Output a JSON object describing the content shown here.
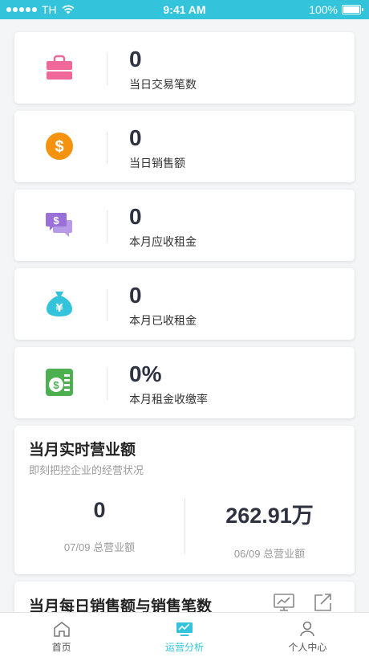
{
  "status_bar": {
    "carrier": "TH",
    "time": "9:41 AM",
    "battery": "100%"
  },
  "stats": [
    {
      "value": "0",
      "label": "当日交易笔数",
      "icon": "shopping-bag-icon",
      "color": "#f0679a"
    },
    {
      "value": "0",
      "label": "当日销售额",
      "icon": "dollar-coin-icon",
      "color": "#f5930f"
    },
    {
      "value": "0",
      "label": "本月应收租金",
      "icon": "chat-dollar-icon",
      "color": "#9b6fd8"
    },
    {
      "value": "0",
      "label": "本月已收租金",
      "icon": "money-bag-yuan-icon",
      "color": "#33c4db"
    },
    {
      "value": "0%",
      "label": "本月租金收缴率",
      "icon": "coin-list-icon",
      "color": "#4caf50"
    }
  ],
  "monthly": {
    "title": "当月实时营业额",
    "subtitle": "即刻把控企业的经营状况",
    "left_value": "0",
    "left_label": "07/09 总营业额",
    "right_value": "262.91万",
    "right_label": "06/09 总营业额"
  },
  "daily": {
    "title": "当月每日销售额与销售笔数",
    "chart_icon": "line-chart-icon",
    "export_icon": "share-icon"
  },
  "tabs": [
    {
      "label": "首页",
      "icon": "home-icon"
    },
    {
      "label": "运营分析",
      "icon": "analytics-icon",
      "active": true
    },
    {
      "label": "个人中心",
      "icon": "person-icon"
    }
  ],
  "colors": {
    "accent": "#33c4db",
    "tab_inactive": "#555555"
  }
}
